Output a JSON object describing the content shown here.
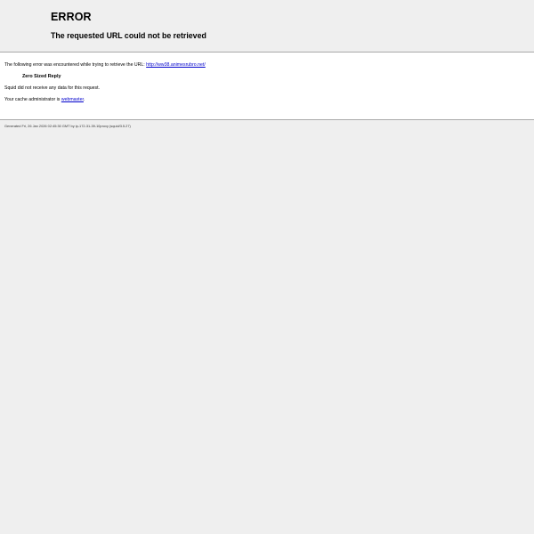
{
  "titles": {
    "heading": "ERROR",
    "subheading": "The requested URL could not be retrieved"
  },
  "error": {
    "intro": "The following error was encountered while trying to retrieve the URL: ",
    "url": "http://ww38.animesrubro.net/",
    "name": "Zero Sized Reply",
    "description": "Squid did not receive any data for this request.",
    "admin_prefix": "Your cache administrator is ",
    "admin_link": "webmaster",
    "admin_suffix": "."
  },
  "footer": {
    "generated": "Generated Fri, 26 Jan 2026 02:45:30 GMT by ip-172-31-39-10proxy (squid/3.5.27)"
  },
  "colors": {
    "background": "#efefef",
    "content_background": "#ffffff",
    "link": "#0000cc"
  }
}
